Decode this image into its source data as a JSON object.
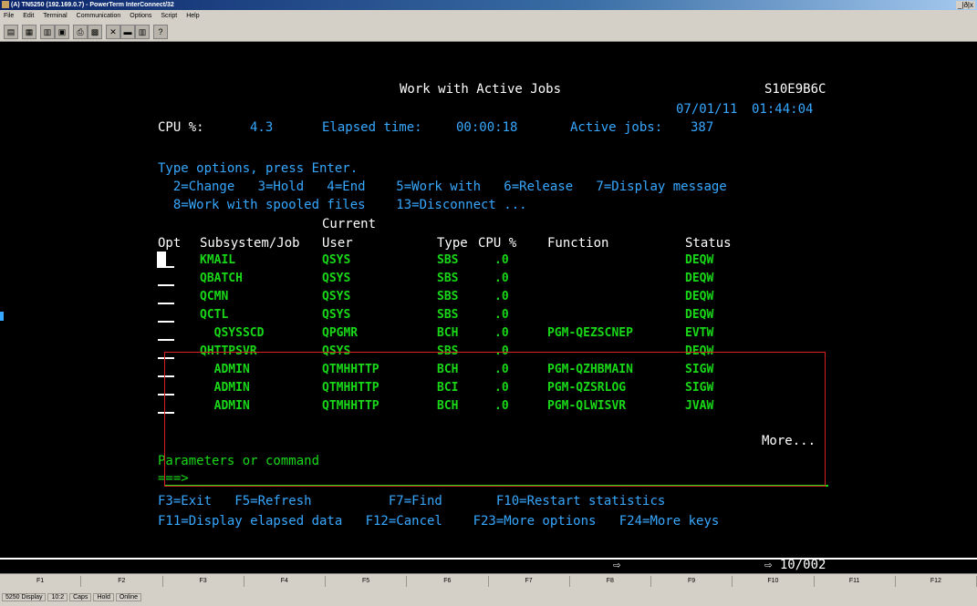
{
  "window": {
    "title": "(A) TN5250 (192.169.0.7) - PowerTerm InterConnect/32",
    "controls": "_|ð|x"
  },
  "menu": [
    "File",
    "Edit",
    "Terminal",
    "Communication",
    "Options",
    "Script",
    "Help"
  ],
  "toolbar": [
    "print-icon",
    "copy-icon",
    "paste-icon",
    "clipboard-icon",
    "printer-icon",
    "screen-icon",
    "keyboard-icon",
    "keypad-icon",
    "macro-icon",
    "help-icon"
  ],
  "screen": {
    "title": "Work with Active Jobs",
    "system": "S10E9B6C",
    "date": "07/01/11",
    "time": "01:44:04",
    "cpu_label": "CPU %:",
    "cpu_value": "4.3",
    "elapsed_label": "Elapsed time:",
    "elapsed_value": "00:00:18",
    "active_label": "Active jobs:",
    "active_value": "387",
    "instructions": "Type options, press Enter.",
    "options1": "  2=Change   3=Hold   4=End    5=Work with   6=Release   7=Display message",
    "options2": "  8=Work with spooled files    13=Disconnect ...",
    "hdr_current": "Current",
    "hdr_opt": "Opt",
    "hdr_job": "Subsystem/Job",
    "hdr_user": "User",
    "hdr_type": "Type",
    "hdr_cpu": "CPU %",
    "hdr_func": "Function",
    "hdr_status": "Status",
    "rows": [
      {
        "job": "KMAIL",
        "user": "QSYS",
        "type": "SBS",
        "cpu": ".0",
        "func": "",
        "status": "DEQW"
      },
      {
        "job": "QBATCH",
        "user": "QSYS",
        "type": "SBS",
        "cpu": ".0",
        "func": "",
        "status": "DEQW"
      },
      {
        "job": "QCMN",
        "user": "QSYS",
        "type": "SBS",
        "cpu": ".0",
        "func": "",
        "status": "DEQW"
      },
      {
        "job": "QCTL",
        "user": "QSYS",
        "type": "SBS",
        "cpu": ".0",
        "func": "",
        "status": "DEQW"
      },
      {
        "job": "  QSYSSCD",
        "user": "QPGMR",
        "type": "BCH",
        "cpu": ".0",
        "func": "PGM-QEZSCNEP",
        "status": "EVTW"
      },
      {
        "job": "QHTTPSVR",
        "user": "QSYS",
        "type": "SBS",
        "cpu": ".0",
        "func": "",
        "status": "DEQW"
      },
      {
        "job": "  ADMIN",
        "user": "QTMHHTTP",
        "type": "BCH",
        "cpu": ".0",
        "func": "PGM-QZHBMAIN",
        "status": "SIGW"
      },
      {
        "job": "  ADMIN",
        "user": "QTMHHTTP",
        "type": "BCI",
        "cpu": ".0",
        "func": "PGM-QZSRLOG",
        "status": "SIGW"
      },
      {
        "job": "  ADMIN",
        "user": "QTMHHTTP",
        "type": "BCH",
        "cpu": ".0",
        "func": "PGM-QLWISVR",
        "status": "JVAW"
      }
    ],
    "more": "More...",
    "params_label": "Parameters or command",
    "prompt": "===>",
    "fkeys_line1": "F3=Exit   F5=Refresh          F7=Find       F10=Restart statistics",
    "fkeys_line2": "F11=Display elapsed data   F12=Cancel    F23=More options   F24=More keys",
    "status_arrow": "⇨",
    "cursor_pos": "⇨ 10/002"
  },
  "function_keys": [
    "F1",
    "F2",
    "F3",
    "F4",
    "F5",
    "F6",
    "F7",
    "F8",
    "F9",
    "F10",
    "F11",
    "F12"
  ],
  "statusbar": [
    "5250 Display",
    "10:2",
    "Caps",
    "Hold",
    "Online"
  ]
}
